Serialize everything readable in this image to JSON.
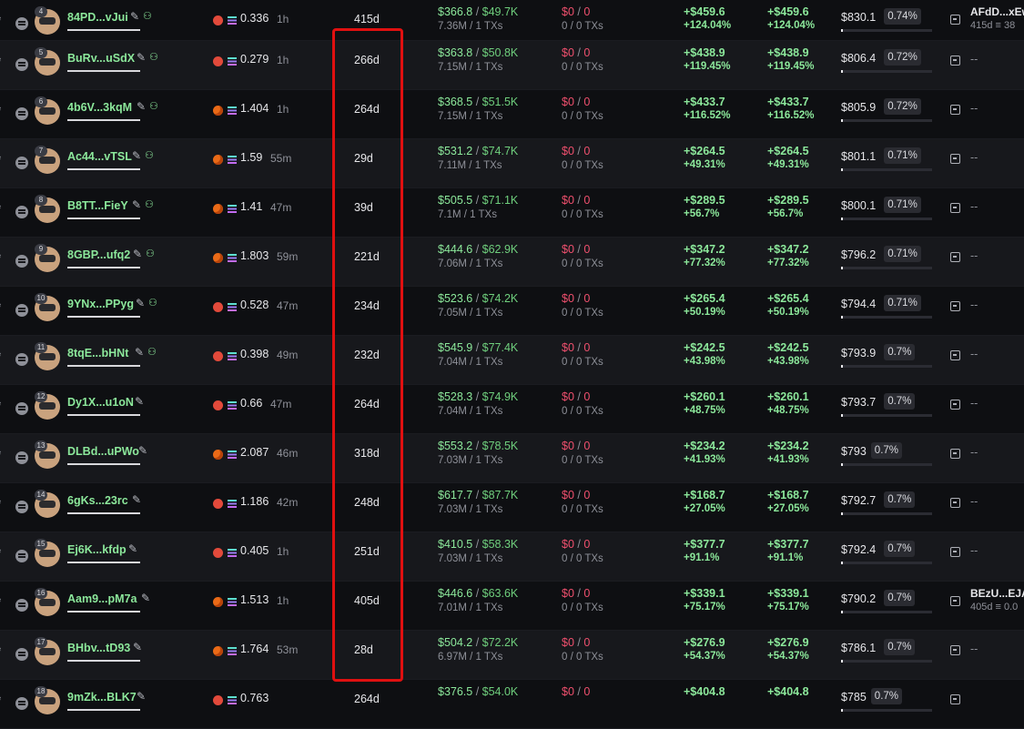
{
  "colors": {
    "positive": "#8ce89b",
    "negative": "#f0506e",
    "highlight": "#e01010",
    "background": "#0e0f12"
  },
  "icons": {
    "filter": "filter-icon",
    "copy": "copy-icon",
    "edit": "edit-icon",
    "user": "user-icon",
    "solana": "solana-icon",
    "exit": "transfer-out-icon"
  },
  "rows": [
    {
      "rank": "4",
      "wallet": "84PD...vJui",
      "has_user": true,
      "src": "a",
      "balance": "0.336",
      "balance_time": "1h",
      "age": "415d",
      "buy_usd": "$366.8",
      "buy_total": "$49.7K",
      "buy_sub": "7.36M / 1 TXs",
      "sell_usd": "$0",
      "sell_total": "0",
      "sell_sub": "0 / 0 TXs",
      "realized": "+$459.6",
      "realized_pct": "+124.04%",
      "total": "+$459.6",
      "total_pct": "+124.04%",
      "holding": "$830.1",
      "holding_pct": "0.74%",
      "hold_fill": 0.02,
      "dest_name": "AFdD...xEw",
      "dest_sub": "415d ≡ 38"
    },
    {
      "rank": "5",
      "wallet": "BuRv...uSdX",
      "has_user": true,
      "src": "a",
      "balance": "0.279",
      "balance_time": "1h",
      "age": "266d",
      "buy_usd": "$363.8",
      "buy_total": "$50.8K",
      "buy_sub": "7.15M / 1 TXs",
      "sell_usd": "$0",
      "sell_total": "0",
      "sell_sub": "0 / 0 TXs",
      "realized": "+$438.9",
      "realized_pct": "+119.45%",
      "total": "+$438.9",
      "total_pct": "+119.45%",
      "holding": "$806.4",
      "holding_pct": "0.72%",
      "hold_fill": 0.02,
      "dest": "--"
    },
    {
      "rank": "6",
      "wallet": "4b6V...3kqM",
      "has_user": true,
      "src": "b",
      "balance": "1.404",
      "balance_time": "1h",
      "age": "264d",
      "buy_usd": "$368.5",
      "buy_total": "$51.5K",
      "buy_sub": "7.15M / 1 TXs",
      "sell_usd": "$0",
      "sell_total": "0",
      "sell_sub": "0 / 0 TXs",
      "realized": "+$433.7",
      "realized_pct": "+116.52%",
      "total": "+$433.7",
      "total_pct": "+116.52%",
      "holding": "$805.9",
      "holding_pct": "0.72%",
      "hold_fill": 0.02,
      "dest": "--"
    },
    {
      "rank": "7",
      "wallet": "Ac44...vTSL",
      "has_user": true,
      "src": "b",
      "balance": "1.59",
      "balance_time": "55m",
      "age": "29d",
      "buy_usd": "$531.2",
      "buy_total": "$74.7K",
      "buy_sub": "7.11M / 1 TXs",
      "sell_usd": "$0",
      "sell_total": "0",
      "sell_sub": "0 / 0 TXs",
      "realized": "+$264.5",
      "realized_pct": "+49.31%",
      "total": "+$264.5",
      "total_pct": "+49.31%",
      "holding": "$801.1",
      "holding_pct": "0.71%",
      "hold_fill": 0.02,
      "dest": "--"
    },
    {
      "rank": "8",
      "wallet": "B8TT...FieY",
      "has_user": true,
      "src": "b",
      "balance": "1.41",
      "balance_time": "47m",
      "age": "39d",
      "buy_usd": "$505.5",
      "buy_total": "$71.1K",
      "buy_sub": "7.1M / 1 TXs",
      "sell_usd": "$0",
      "sell_total": "0",
      "sell_sub": "0 / 0 TXs",
      "realized": "+$289.5",
      "realized_pct": "+56.7%",
      "total": "+$289.5",
      "total_pct": "+56.7%",
      "holding": "$800.1",
      "holding_pct": "0.71%",
      "hold_fill": 0.02,
      "dest": "--"
    },
    {
      "rank": "9",
      "wallet": "8GBP...ufq2",
      "has_user": true,
      "src": "b",
      "balance": "1.803",
      "balance_time": "59m",
      "age": "221d",
      "buy_usd": "$444.6",
      "buy_total": "$62.9K",
      "buy_sub": "7.06M / 1 TXs",
      "sell_usd": "$0",
      "sell_total": "0",
      "sell_sub": "0 / 0 TXs",
      "realized": "+$347.2",
      "realized_pct": "+77.32%",
      "total": "+$347.2",
      "total_pct": "+77.32%",
      "holding": "$796.2",
      "holding_pct": "0.71%",
      "hold_fill": 0.02,
      "dest": "--"
    },
    {
      "rank": "10",
      "wallet": "9YNx...PPyg",
      "has_user": true,
      "src": "a",
      "balance": "0.528",
      "balance_time": "47m",
      "age": "234d",
      "buy_usd": "$523.6",
      "buy_total": "$74.2K",
      "buy_sub": "7.05M / 1 TXs",
      "sell_usd": "$0",
      "sell_total": "0",
      "sell_sub": "0 / 0 TXs",
      "realized": "+$265.4",
      "realized_pct": "+50.19%",
      "total": "+$265.4",
      "total_pct": "+50.19%",
      "holding": "$794.4",
      "holding_pct": "0.71%",
      "hold_fill": 0.02,
      "dest": "--"
    },
    {
      "rank": "11",
      "wallet": "8tqE...bHNt",
      "has_user": true,
      "src": "a",
      "balance": "0.398",
      "balance_time": "49m",
      "age": "232d",
      "buy_usd": "$545.9",
      "buy_total": "$77.4K",
      "buy_sub": "7.04M / 1 TXs",
      "sell_usd": "$0",
      "sell_total": "0",
      "sell_sub": "0 / 0 TXs",
      "realized": "+$242.5",
      "realized_pct": "+43.98%",
      "total": "+$242.5",
      "total_pct": "+43.98%",
      "holding": "$793.9",
      "holding_pct": "0.7%",
      "hold_fill": 0.02,
      "dest": "--"
    },
    {
      "rank": "12",
      "wallet": "Dy1X...u1oN",
      "has_user": false,
      "src": "a",
      "balance": "0.66",
      "balance_time": "47m",
      "age": "264d",
      "buy_usd": "$528.3",
      "buy_total": "$74.9K",
      "buy_sub": "7.04M / 1 TXs",
      "sell_usd": "$0",
      "sell_total": "0",
      "sell_sub": "0 / 0 TXs",
      "realized": "+$260.1",
      "realized_pct": "+48.75%",
      "total": "+$260.1",
      "total_pct": "+48.75%",
      "holding": "$793.7",
      "holding_pct": "0.7%",
      "hold_fill": 0.02,
      "dest": "--"
    },
    {
      "rank": "13",
      "wallet": "DLBd...uPWo",
      "has_user": false,
      "src": "b",
      "balance": "2.087",
      "balance_time": "46m",
      "age": "318d",
      "buy_usd": "$553.2",
      "buy_total": "$78.5K",
      "buy_sub": "7.03M / 1 TXs",
      "sell_usd": "$0",
      "sell_total": "0",
      "sell_sub": "0 / 0 TXs",
      "realized": "+$234.2",
      "realized_pct": "+41.93%",
      "total": "+$234.2",
      "total_pct": "+41.93%",
      "holding": "$793",
      "holding_pct": "0.7%",
      "hold_fill": 0.02,
      "dest": "--"
    },
    {
      "rank": "14",
      "wallet": "6gKs...23rc",
      "has_user": false,
      "src": "a",
      "balance": "1.186",
      "balance_time": "42m",
      "age": "248d",
      "buy_usd": "$617.7",
      "buy_total": "$87.7K",
      "buy_sub": "7.03M / 1 TXs",
      "sell_usd": "$0",
      "sell_total": "0",
      "sell_sub": "0 / 0 TXs",
      "realized": "+$168.7",
      "realized_pct": "+27.05%",
      "total": "+$168.7",
      "total_pct": "+27.05%",
      "holding": "$792.7",
      "holding_pct": "0.7%",
      "hold_fill": 0.02,
      "dest": "--"
    },
    {
      "rank": "15",
      "wallet": "Ej6K...kfdp",
      "has_user": false,
      "src": "a",
      "balance": "0.405",
      "balance_time": "1h",
      "age": "251d",
      "buy_usd": "$410.5",
      "buy_total": "$58.3K",
      "buy_sub": "7.03M / 1 TXs",
      "sell_usd": "$0",
      "sell_total": "0",
      "sell_sub": "0 / 0 TXs",
      "realized": "+$377.7",
      "realized_pct": "+91.1%",
      "total": "+$377.7",
      "total_pct": "+91.1%",
      "holding": "$792.4",
      "holding_pct": "0.7%",
      "hold_fill": 0.02,
      "dest": "--"
    },
    {
      "rank": "16",
      "wallet": "Aam9...pM7a",
      "has_user": false,
      "src": "b",
      "balance": "1.513",
      "balance_time": "1h",
      "age": "405d",
      "buy_usd": "$446.6",
      "buy_total": "$63.6K",
      "buy_sub": "7.01M / 1 TXs",
      "sell_usd": "$0",
      "sell_total": "0",
      "sell_sub": "0 / 0 TXs",
      "realized": "+$339.1",
      "realized_pct": "+75.17%",
      "total": "+$339.1",
      "total_pct": "+75.17%",
      "holding": "$790.2",
      "holding_pct": "0.7%",
      "hold_fill": 0.02,
      "dest_name": "BEzU...EJA",
      "dest_sub": "405d ≡ 0.0"
    },
    {
      "rank": "17",
      "wallet": "BHbv...tD93",
      "has_user": false,
      "src": "b",
      "balance": "1.764",
      "balance_time": "53m",
      "age": "28d",
      "buy_usd": "$504.2",
      "buy_total": "$72.2K",
      "buy_sub": "6.97M / 1 TXs",
      "sell_usd": "$0",
      "sell_total": "0",
      "sell_sub": "0 / 0 TXs",
      "realized": "+$276.9",
      "realized_pct": "+54.37%",
      "total": "+$276.9",
      "total_pct": "+54.37%",
      "holding": "$786.1",
      "holding_pct": "0.7%",
      "hold_fill": 0.02,
      "dest": "--"
    },
    {
      "rank": "18",
      "wallet": "9mZk...BLK7",
      "has_user": false,
      "src": "a",
      "balance": "0.763",
      "balance_time": "",
      "age": "264d",
      "buy_usd": "$376.5",
      "buy_total": "$54.0K",
      "buy_sub": "",
      "sell_usd": "$0",
      "sell_total": "0",
      "sell_sub": "",
      "realized": "+$404.8",
      "realized_pct": "",
      "total": "+$404.8",
      "total_pct": "",
      "holding": "$785",
      "holding_pct": "0.7%",
      "hold_fill": 0.02,
      "dest": ""
    }
  ]
}
